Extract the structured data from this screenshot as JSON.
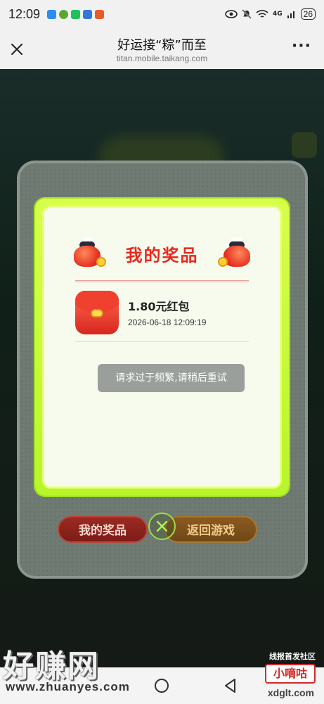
{
  "status_bar": {
    "time": "12:09",
    "network": "4G",
    "battery": "26",
    "colors": {
      "notif_1": "#2d8cf0",
      "notif_2": "#5aa832",
      "notif_3": "#20c05c",
      "notif_4": "#3478d6",
      "notif_5": "#e85c2a"
    }
  },
  "browser": {
    "title": "好运接“粽”而至",
    "url": "titan.mobile.taikang.com",
    "close_icon": "close-icon",
    "more_icon": "more-icon"
  },
  "dialog": {
    "heading": "我的奖品",
    "prize": {
      "name": "1.80元红包",
      "time": "2026-06-18 12:09:19",
      "icon": "red-packet-icon"
    },
    "toast": "请求过于频繁,请稍后重试",
    "buttons": {
      "my_prizes": "我的奖品",
      "back_to_game": "返回游戏"
    },
    "colors": {
      "accent_green": "#b8f52a",
      "heading_red": "#e8281e"
    }
  },
  "watermark": {
    "left_title": "好赚网",
    "left_url": "www.zhuanyes.com",
    "right_caption": "线报首发社区",
    "right_logo": "小嘀咕",
    "right_url": "xdglt.com"
  }
}
